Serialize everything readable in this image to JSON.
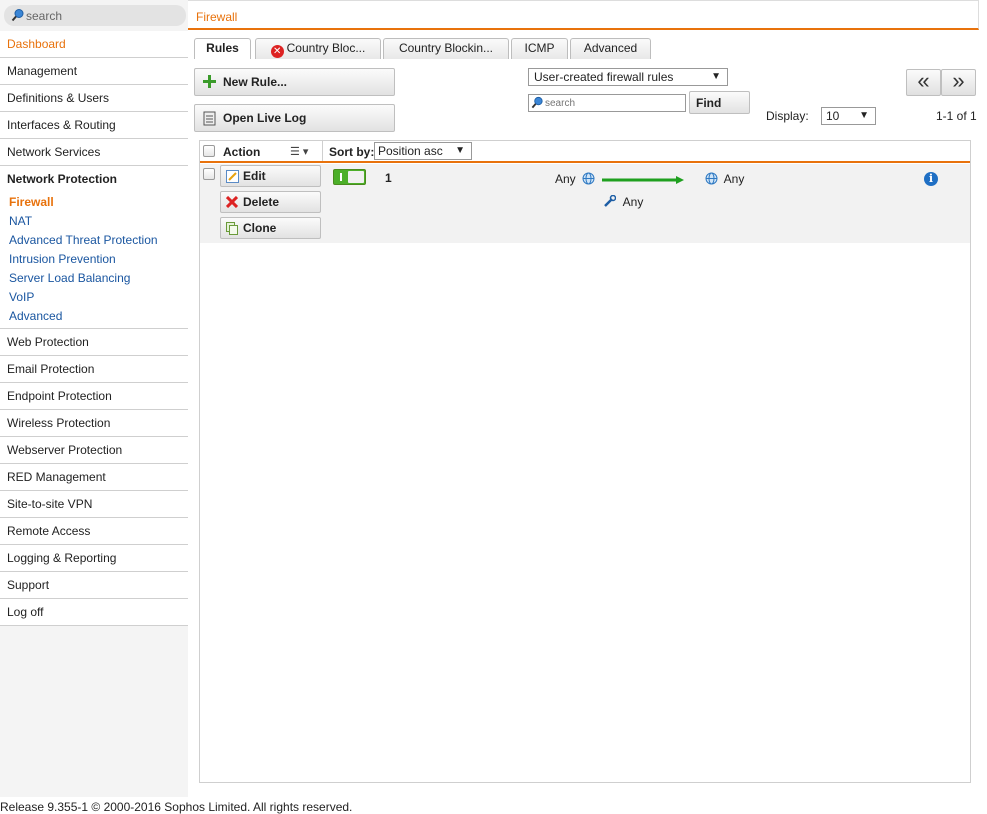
{
  "search": {
    "placeholder": "search"
  },
  "sidebar": {
    "items_top": [
      {
        "label": "Dashboard"
      },
      {
        "label": "Management"
      },
      {
        "label": "Definitions & Users"
      },
      {
        "label": "Interfaces & Routing"
      },
      {
        "label": "Network Services"
      }
    ],
    "section": {
      "label": "Network Protection"
    },
    "sub_items": [
      {
        "label": "Firewall"
      },
      {
        "label": "NAT"
      },
      {
        "label": "Advanced Threat Protection"
      },
      {
        "label": "Intrusion Prevention"
      },
      {
        "label": "Server Load Balancing"
      },
      {
        "label": "VoIP"
      },
      {
        "label": "Advanced"
      }
    ],
    "items_bottom": [
      {
        "label": "Web Protection"
      },
      {
        "label": "Email Protection"
      },
      {
        "label": "Endpoint Protection"
      },
      {
        "label": "Wireless Protection"
      },
      {
        "label": "Webserver Protection"
      },
      {
        "label": "RED Management"
      },
      {
        "label": "Site-to-site VPN"
      },
      {
        "label": "Remote Access"
      },
      {
        "label": "Logging & Reporting"
      },
      {
        "label": "Support"
      },
      {
        "label": "Log off"
      }
    ]
  },
  "header": {
    "title": "Firewall"
  },
  "tabs": [
    {
      "label": "Rules"
    },
    {
      "label": "Country Bloc..."
    },
    {
      "label": "Country Blockin..."
    },
    {
      "label": "ICMP"
    },
    {
      "label": "Advanced"
    }
  ],
  "toolbar": {
    "new_rule": "New Rule...",
    "open_live_log": "Open Live Log",
    "filter_select": "User-created firewall rules",
    "search_placeholder": "search",
    "find": "Find",
    "display_label": "Display:",
    "display_value": "10",
    "pager_prev": "«",
    "pager_next": "»",
    "pager_range": "1-1 of 1"
  },
  "list": {
    "action_header": "Action",
    "sort_label": "Sort by:",
    "sort_value": "Position asc",
    "rule": {
      "edit": "Edit",
      "delete": "Delete",
      "clone": "Clone",
      "position": "1",
      "source": "Any",
      "destination": "Any",
      "service": "Any"
    }
  },
  "footer": {
    "text": "Release 9.355-1  © 2000-2016 Sophos Limited. All rights reserved."
  },
  "colors": {
    "accent": "#e8720c",
    "link": "#1a56a0",
    "enabled": "#4caf29"
  }
}
